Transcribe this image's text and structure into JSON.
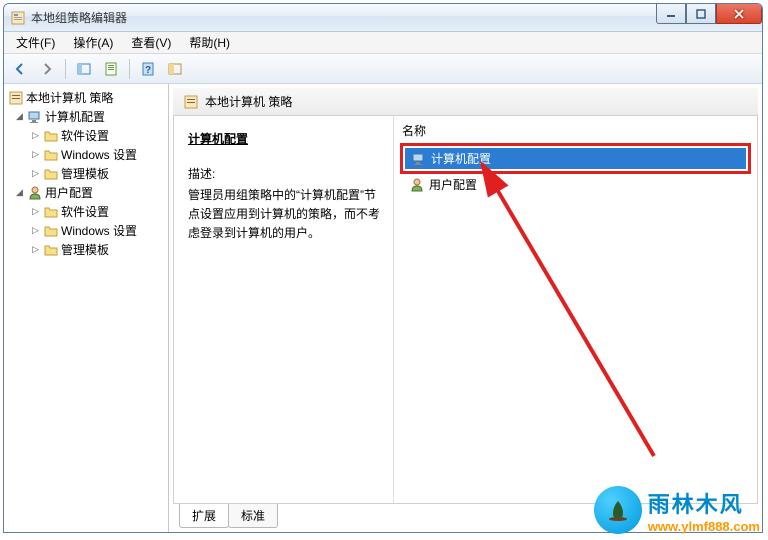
{
  "window": {
    "title": "本地组策略编辑器"
  },
  "menu": {
    "file": "文件(F)",
    "action": "操作(A)",
    "view": "查看(V)",
    "help": "帮助(H)"
  },
  "tree": {
    "root": "本地计算机 策略",
    "computer_config": "计算机配置",
    "user_config": "用户配置",
    "software_settings": "软件设置",
    "windows_settings": "Windows 设置",
    "admin_templates": "管理模板"
  },
  "detail": {
    "header_title": "本地计算机 策略",
    "section_title": "计算机配置",
    "desc_label": "描述:",
    "desc_text": "管理员用组策略中的“计算机配置”节点设置应用到计算机的策略，而不考虑登录到计算机的用户。",
    "col_name": "名称",
    "items": {
      "computer": "计算机配置",
      "user": "用户配置"
    }
  },
  "tabs": {
    "extended": "扩展",
    "standard": "标准"
  },
  "watermark": {
    "brand": "雨林木风",
    "url": "www.ylmf888.com"
  }
}
